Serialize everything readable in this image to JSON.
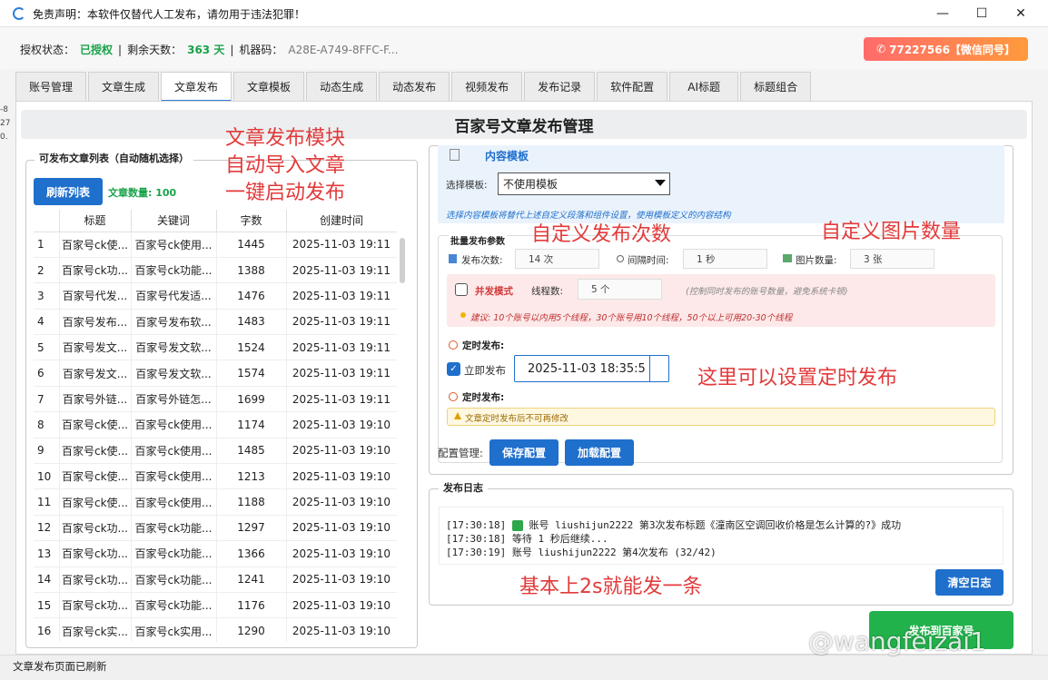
{
  "window": {
    "title": "免责声明：本软件仅替代人工发布，请勿用于违法犯罪！"
  },
  "auth": {
    "status_label": "授权状态：",
    "status_value": "已授权",
    "sep1": "|",
    "days_label": "剩余天数：",
    "days_value": "363 天",
    "sep2": "|",
    "machine_label": "机器码：",
    "machine_value": "A28E-A749-8FFC-F..."
  },
  "contact_button": "77227566【微信同号】",
  "tabs": [
    "账号管理",
    "文章生成",
    "文章发布",
    "文章模板",
    "动态生成",
    "动态发布",
    "视频发布",
    "发布记录",
    "软件配置",
    "AI标题",
    "标题组合"
  ],
  "active_tab": "文章发布",
  "page_title": "百家号文章发布管理",
  "left": {
    "group_title": "可发布文章列表（自动随机选择）",
    "refresh_button": "刷新列表",
    "article_count": "文章数量: 100",
    "columns": [
      "",
      "标题",
      "关键词",
      "字数",
      "创建时间"
    ],
    "rows": [
      [
        "1",
        "百家号ck使...",
        "百家号ck使用...",
        "1445",
        "2025-11-03 19:11"
      ],
      [
        "2",
        "百家号ck功...",
        "百家号ck功能...",
        "1388",
        "2025-11-03 19:11"
      ],
      [
        "3",
        "百家号代发...",
        "百家号代发适...",
        "1476",
        "2025-11-03 19:11"
      ],
      [
        "4",
        "百家号发布...",
        "百家号发布软...",
        "1483",
        "2025-11-03 19:11"
      ],
      [
        "5",
        "百家号发文...",
        "百家号发文软...",
        "1524",
        "2025-11-03 19:11"
      ],
      [
        "6",
        "百家号发文...",
        "百家号发文软...",
        "1574",
        "2025-11-03 19:11"
      ],
      [
        "7",
        "百家号外链...",
        "百家号外链怎...",
        "1699",
        "2025-11-03 19:11"
      ],
      [
        "8",
        "百家号ck使...",
        "百家号ck使用...",
        "1174",
        "2025-11-03 19:10"
      ],
      [
        "9",
        "百家号ck使...",
        "百家号ck使用...",
        "1485",
        "2025-11-03 19:10"
      ],
      [
        "10",
        "百家号ck使...",
        "百家号ck使用...",
        "1213",
        "2025-11-03 19:10"
      ],
      [
        "11",
        "百家号ck使...",
        "百家号ck使用...",
        "1188",
        "2025-11-03 19:10"
      ],
      [
        "12",
        "百家号ck功...",
        "百家号ck功能...",
        "1297",
        "2025-11-03 19:10"
      ],
      [
        "13",
        "百家号ck功...",
        "百家号ck功能...",
        "1366",
        "2025-11-03 19:10"
      ],
      [
        "14",
        "百家号ck功...",
        "百家号ck功能...",
        "1241",
        "2025-11-03 19:10"
      ],
      [
        "15",
        "百家号ck功...",
        "百家号ck功能...",
        "1176",
        "2025-11-03 19:10"
      ],
      [
        "16",
        "百家号ck实...",
        "百家号ck实用...",
        "1290",
        "2025-11-03 19:10"
      ]
    ]
  },
  "template": {
    "title": "内容模板",
    "select_label": "选择模板:",
    "select_value": "不使用模板",
    "note": "选择内容模板将替代上述自定义段落和组件设置，使用模板定义的内容结构"
  },
  "batch": {
    "title": "批量发布参数",
    "count_label": "发布次数:",
    "count_value": "14 次",
    "interval_label": "间隔时间:",
    "interval_value": "1 秒",
    "images_label": "图片数量:",
    "images_value": "3 张",
    "concurrent_label": "并发模式",
    "threads_label": "线程数:",
    "threads_value": "5 个",
    "threads_hint": "(控制同时发布的账号数量，避免系统卡顿)",
    "suggestion": "建议: 10个账号以内用5个线程，30个账号用10个线程，50个以上可用20-30个线程",
    "scheduled_label_1": "定时发布:",
    "instant_label": "立即发布",
    "datetime_value": "2025-11-03 18:35:5",
    "scheduled_label_2": "定时发布:",
    "warning": "文章定时发布后不可再修改"
  },
  "config": {
    "label": "配置管理:",
    "save_button": "保存配置",
    "load_button": "加载配置"
  },
  "log": {
    "title": "发布日志",
    "lines": [
      "[17:30:18]",
      "账号 liushijun2222 第3次发布标题《潼南区空调回收价格是怎么计算的?》成功",
      "[17:30:18] 等待 1 秒后继续...",
      "[17:30:19] 账号 liushijun2222 第4次发布 (32/42)"
    ],
    "clear_button": "清空日志"
  },
  "publish_button": "发布到百家号",
  "status_bar": "文章发布页面已刷新",
  "annotations": {
    "a1": "文章发布模块",
    "a2": "自动导入文章",
    "a3": "一键启动发布",
    "a4": "自定义发布次数",
    "a5": "自定义图片数量",
    "a6": "这里可以设置定时发布",
    "a7": "基本上2s就能发一条"
  },
  "watermark": "@wangfeizai1",
  "edge_fragments": [
    "-8",
    "27",
    "0."
  ]
}
